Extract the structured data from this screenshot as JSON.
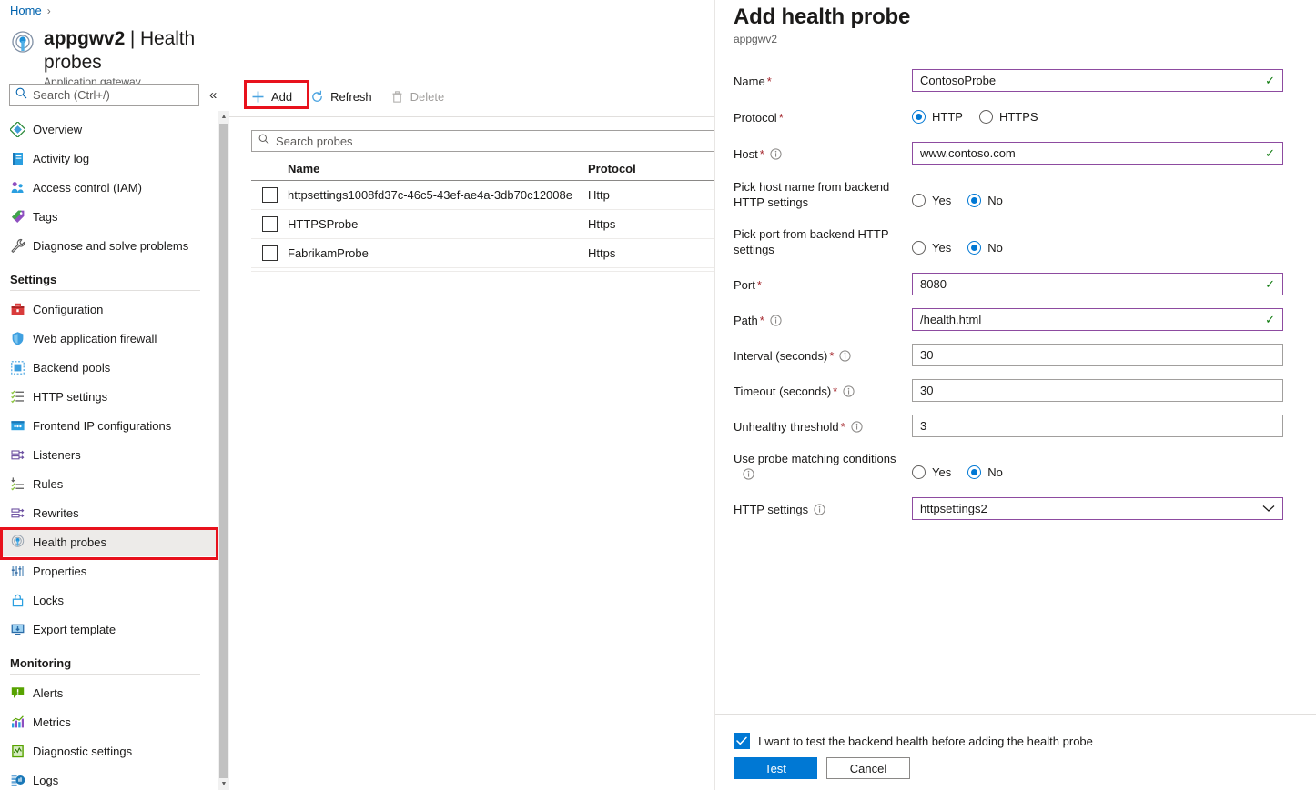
{
  "breadcrumb": {
    "home": "Home",
    "separator": "›"
  },
  "resource": {
    "title_bold": "appgwv2",
    "title_divider": " | ",
    "title_page": "Health probes",
    "subtitle": "Application gateway",
    "icon": "application-gateway-icon"
  },
  "nav_search": {
    "placeholder": "Search (Ctrl+/)",
    "collapse_glyph": "«"
  },
  "sidebar": {
    "items": [
      {
        "label": "Overview",
        "icon": "overview-icon",
        "type": "item"
      },
      {
        "label": "Activity log",
        "icon": "activity-log-icon",
        "type": "item"
      },
      {
        "label": "Access control (IAM)",
        "icon": "access-control-icon",
        "type": "item"
      },
      {
        "label": "Tags",
        "icon": "tags-icon",
        "type": "item"
      },
      {
        "label": "Diagnose and solve problems",
        "icon": "wrench-icon",
        "type": "item"
      },
      {
        "label": "Settings",
        "type": "group"
      },
      {
        "label": "Configuration",
        "icon": "configuration-icon",
        "type": "item"
      },
      {
        "label": "Web application firewall",
        "icon": "shield-icon",
        "type": "item"
      },
      {
        "label": "Backend pools",
        "icon": "backend-pools-icon",
        "type": "item"
      },
      {
        "label": "HTTP settings",
        "icon": "http-settings-icon",
        "type": "item"
      },
      {
        "label": "Frontend IP configurations",
        "icon": "frontend-ip-icon",
        "type": "item"
      },
      {
        "label": "Listeners",
        "icon": "listeners-icon",
        "type": "item"
      },
      {
        "label": "Rules",
        "icon": "rules-icon",
        "type": "item"
      },
      {
        "label": "Rewrites",
        "icon": "rewrites-icon",
        "type": "item"
      },
      {
        "label": "Health probes",
        "icon": "health-probes-icon",
        "type": "item",
        "selected": true
      },
      {
        "label": "Properties",
        "icon": "properties-icon",
        "type": "item"
      },
      {
        "label": "Locks",
        "icon": "lock-icon",
        "type": "item"
      },
      {
        "label": "Export template",
        "icon": "export-template-icon",
        "type": "item"
      },
      {
        "label": "Monitoring",
        "type": "group"
      },
      {
        "label": "Alerts",
        "icon": "alerts-icon",
        "type": "item"
      },
      {
        "label": "Metrics",
        "icon": "metrics-icon",
        "type": "item"
      },
      {
        "label": "Diagnostic settings",
        "icon": "diagnostic-settings-icon",
        "type": "item"
      },
      {
        "label": "Logs",
        "icon": "logs-icon",
        "type": "item"
      }
    ]
  },
  "toolbar": {
    "add_label": "Add",
    "refresh_label": "Refresh",
    "delete_label": "Delete"
  },
  "probe_search": {
    "placeholder": "Search probes"
  },
  "table": {
    "columns": [
      "Name",
      "Protocol"
    ],
    "rows": [
      {
        "name": "httpsettings1008fd37c-46c5-43ef-ae4a-3db70c12008e",
        "protocol": "Http"
      },
      {
        "name": "HTTPSProbe",
        "protocol": "Https"
      },
      {
        "name": "FabrikamProbe",
        "protocol": "Https"
      }
    ]
  },
  "panel": {
    "title": "Add health probe",
    "subtitle": "appgwv2",
    "fields": {
      "name": {
        "label": "Name",
        "required": true,
        "value": "ContosoProbe",
        "valid": true
      },
      "protocol": {
        "label": "Protocol",
        "required": true,
        "options": [
          "HTTP",
          "HTTPS"
        ],
        "selected": "HTTP"
      },
      "host": {
        "label": "Host",
        "required": true,
        "info": true,
        "value": "www.contoso.com",
        "valid": true
      },
      "pick_host": {
        "label": "Pick host name from backend HTTP settings",
        "options": [
          "Yes",
          "No"
        ],
        "selected": "No"
      },
      "pick_port": {
        "label": "Pick port from backend HTTP settings",
        "options": [
          "Yes",
          "No"
        ],
        "selected": "No"
      },
      "port": {
        "label": "Port",
        "required": true,
        "value": "8080",
        "valid": true
      },
      "path": {
        "label": "Path",
        "required": true,
        "info": true,
        "value": "/health.html",
        "valid": true
      },
      "interval": {
        "label": "Interval (seconds)",
        "required": true,
        "info": true,
        "value": "30",
        "valid": false
      },
      "timeout": {
        "label": "Timeout (seconds)",
        "required": true,
        "info": true,
        "value": "30",
        "valid": false
      },
      "unhealthy_threshold": {
        "label": "Unhealthy threshold",
        "required": true,
        "info": true,
        "value": "3",
        "valid": false
      },
      "probe_matching": {
        "label": "Use probe matching conditions",
        "info": true,
        "options": [
          "Yes",
          "No"
        ],
        "selected": "No"
      },
      "http_settings": {
        "label": "HTTP settings",
        "info": true,
        "value": "httpsettings2",
        "options": [
          "httpsettings2"
        ]
      }
    },
    "footer": {
      "checkbox_label": "I want to test the backend health before adding the health probe",
      "checkbox_checked": true,
      "test_label": "Test",
      "cancel_label": "Cancel"
    }
  },
  "colors": {
    "accent": "#0078d4",
    "highlight_red": "#e8111c",
    "input_border": "#8d4ba0",
    "valid_green": "#107c10",
    "required_red": "#a4262c"
  }
}
